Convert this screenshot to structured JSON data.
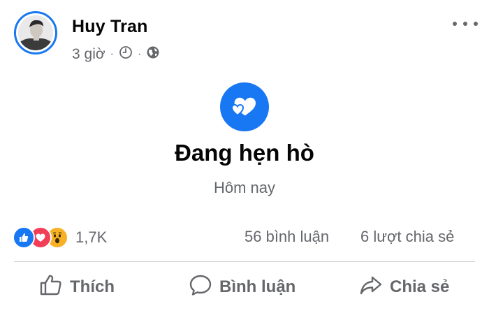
{
  "post": {
    "author": "Huy Tran",
    "time": "3 giờ",
    "separator": "·",
    "icons": {
      "clock": "clock-icon",
      "audience": "globe-icon",
      "more": "more-options-icon"
    }
  },
  "life_event": {
    "icon": "hearts-icon",
    "title": "Đang hẹn hò",
    "date": "Hôm nay"
  },
  "stats": {
    "reactions": [
      "like",
      "love",
      "wow"
    ],
    "reaction_count": "1,7K",
    "comments": "56 bình luận",
    "shares": "6 lượt chia sẻ"
  },
  "actions": {
    "like": "Thích",
    "comment": "Bình luận",
    "share": "Chia sẻ"
  },
  "colors": {
    "accent": "#1877f2",
    "love": "#f33e58",
    "wow": "#f7b125",
    "secondary_text": "#65676b"
  }
}
